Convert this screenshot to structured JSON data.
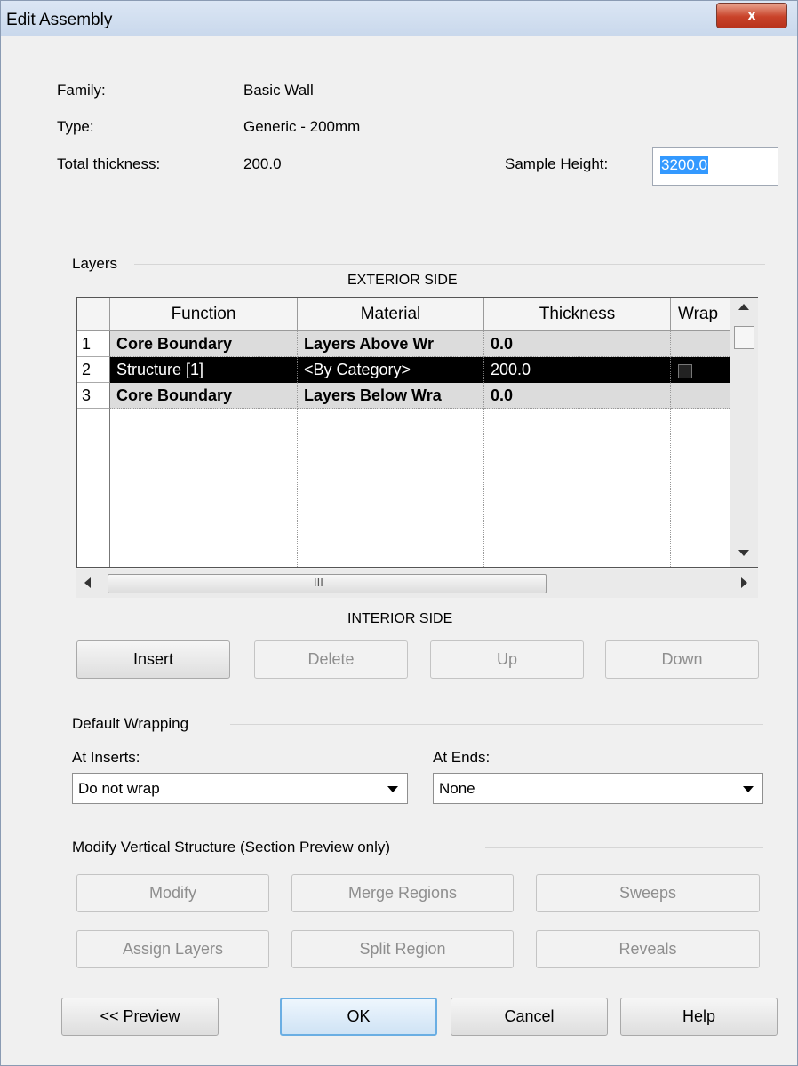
{
  "window": {
    "title": "Edit Assembly",
    "close_label": "x"
  },
  "info": {
    "family_label": "Family:",
    "family_value": "Basic Wall",
    "type_label": "Type:",
    "type_value": "Generic - 200mm",
    "thickness_label": "Total thickness:",
    "thickness_value": "200.0",
    "sample_height_label": "Sample Height:",
    "sample_height_value": "3200.0"
  },
  "layers": {
    "group_label": "Layers",
    "exterior_label": "EXTERIOR SIDE",
    "interior_label": "INTERIOR SIDE",
    "columns": [
      "Function",
      "Material",
      "Thickness",
      "Wrap"
    ],
    "rows": [
      {
        "num": "1",
        "function": "Core Boundary",
        "material": "Layers Above Wr",
        "thickness": "0.0"
      },
      {
        "num": "2",
        "function": "Structure [1]",
        "material": "<By Category>",
        "thickness": "200.0"
      },
      {
        "num": "3",
        "function": "Core Boundary",
        "material": "Layers Below Wra",
        "thickness": "0.0"
      }
    ],
    "hscroll_grip": "III",
    "buttons": {
      "insert": "Insert",
      "delete": "Delete",
      "up": "Up",
      "down": "Down"
    }
  },
  "wrapping": {
    "group_label": "Default Wrapping",
    "at_inserts_label": "At Inserts:",
    "at_inserts_value": "Do not wrap",
    "at_ends_label": "At Ends:",
    "at_ends_value": "None"
  },
  "vertical": {
    "group_label": "Modify Vertical Structure (Section Preview only)",
    "modify": "Modify",
    "merge": "Merge Regions",
    "sweeps": "Sweeps",
    "assign": "Assign Layers",
    "split": "Split Region",
    "reveals": "Reveals"
  },
  "footer": {
    "preview": "<< Preview",
    "ok": "OK",
    "cancel": "Cancel",
    "help": "Help"
  }
}
